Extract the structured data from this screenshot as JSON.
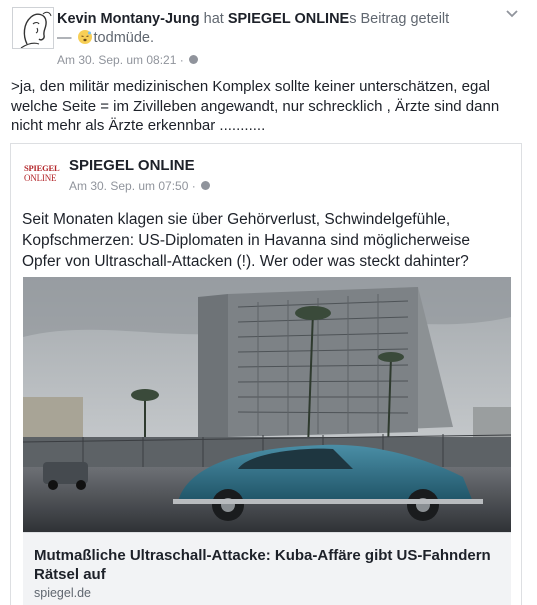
{
  "post": {
    "author": "Kevin Montany-Jung",
    "shared_word": "hat",
    "shared_source": "SPIEGEL ONLINE",
    "shared_suffix": "s Beitrag geteilt",
    "feeling_prefix": "—",
    "feeling": "todmüde.",
    "feeling_icon": "sleepy-face-emoji",
    "timestamp": "Am 30. Sep. um 08:21",
    "meta_separator": "·",
    "privacy_icon": "globe-icon",
    "menu_icon": "chevron-down-icon",
    "text": ">ja, den militär medizinischen Komplex sollte keiner unterschätzen, egal welche Seite = im Zivilleben angewandt, nur schrecklich , Ärzte sind dann nicht mehr als Ärzte erkennbar ..........."
  },
  "shared": {
    "logo_line1": "SPIEGEL",
    "logo_line2": "ONLINE",
    "page_name": "SPIEGEL ONLINE",
    "timestamp": "Am 30. Sep. um 07:50",
    "meta_separator": "·",
    "text": "Seit Monaten klagen sie über Gehörverlust, Schwindelgefühle, Kopfschmerzen: US-Diplomaten in Havanna sind möglicherweise Opfer von Ultraschall-Attacken (!). Wer oder was steckt dahinter?",
    "link_title": "Mutmaßliche Ultraschall-Attacke: Kuba-Affäre gibt US-Fahndern Rätsel auf",
    "link_domain": "spiegel.de"
  },
  "colors": {
    "brand_red": "#b3262a",
    "meta_gray": "#90949c",
    "link_bg": "#f2f3f5"
  }
}
